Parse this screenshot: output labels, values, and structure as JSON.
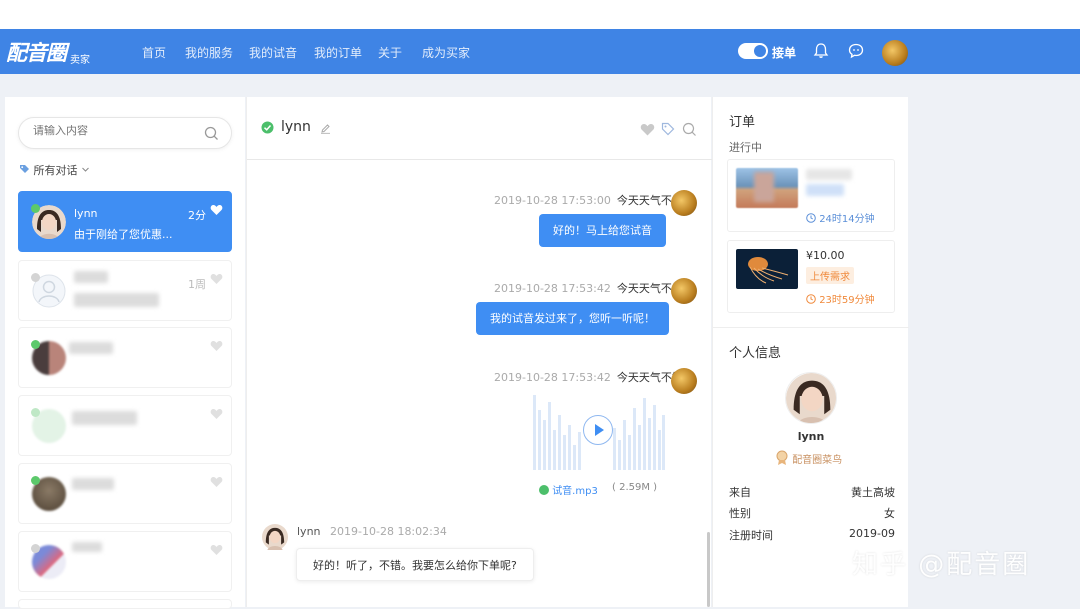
{
  "nav": {
    "logo": "配音圈",
    "logo_sub": "卖家",
    "items": [
      "首页",
      "我的服务",
      "我的试音",
      "我的订单",
      "关于",
      "成为买家"
    ],
    "toggle_label": "接单"
  },
  "left": {
    "search_placeholder": "请输入内容",
    "filter_label": "所有对话",
    "conversations": [
      {
        "name": "lynn",
        "preview": "由于刚给了您优惠...",
        "time": "2分"
      },
      {
        "time": "1周"
      }
    ]
  },
  "chat": {
    "title": "lynn",
    "messages": [
      {
        "timestamp": "2019-10-28 17:53:00",
        "sender": "今天天气不错",
        "text": "好的！马上给您试音"
      },
      {
        "timestamp": "2019-10-28 17:53:42",
        "sender": "今天天气不错",
        "text": "我的试音发过来了，您听一听呢！"
      },
      {
        "timestamp": "2019-10-28 17:53:42",
        "sender": "今天天气不错",
        "file_name": "试音.mp3",
        "file_size": "( 2.59M )"
      },
      {
        "sender": "lynn",
        "timestamp": "2019-10-28 18:02:34",
        "text": "好的！听了，不错。我要怎么给你下单呢?"
      }
    ]
  },
  "right": {
    "order_title": "订单",
    "order_status": "进行中",
    "orders": [
      {
        "timer": "24时14分钟"
      },
      {
        "price": "¥10.00",
        "tag": "上传需求",
        "timer": "23时59分钟"
      }
    ],
    "profile_title": "个人信息",
    "profile_name": "lynn",
    "badge": "配音圈菜鸟",
    "info": [
      {
        "label": "来自",
        "value": "黄土高坡"
      },
      {
        "label": "性别",
        "value": "女"
      },
      {
        "label": "注册时间",
        "value": "2019-09"
      }
    ]
  },
  "watermark": "知乎 @配音圈",
  "colors": {
    "primary": "#3f84e5",
    "bubble": "#3f8ef3",
    "timer_orange": "#f08a3c"
  }
}
